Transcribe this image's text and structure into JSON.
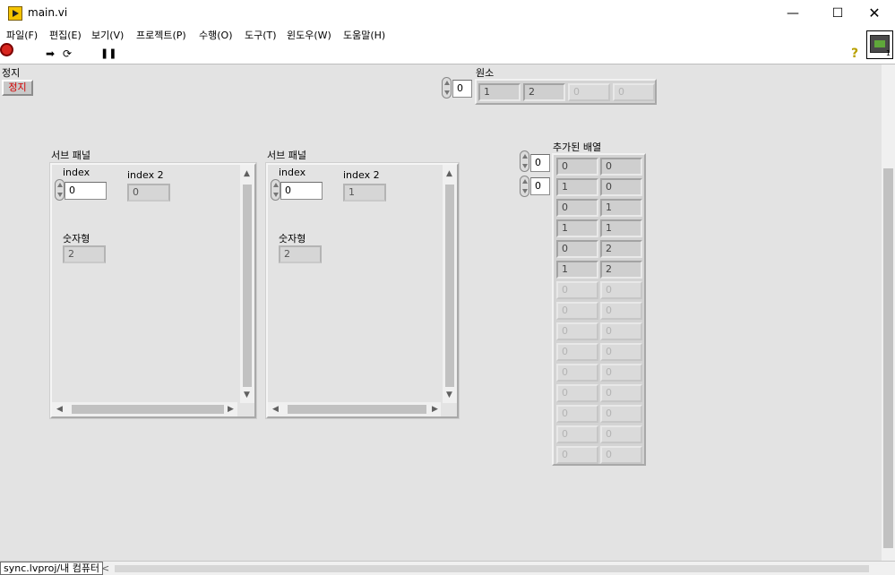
{
  "window": {
    "title": "main.vi",
    "minimize": "—",
    "maximize": "☐",
    "close": "✕"
  },
  "menu": [
    "파일(F)",
    "편집(E)",
    "보기(V)",
    "프로젝트(P)",
    "수행(O)",
    "도구(T)",
    "윈도우(W)",
    "도움말(H)"
  ],
  "toolbar": {
    "run_icon": "run-arrow-icon",
    "run_cont_icon": "run-continuously-icon",
    "abort_icon": "abort-stop-icon",
    "pause_icon": "pause-icon",
    "help": "?",
    "vi_icon_num": "1"
  },
  "stop": {
    "label": "정지",
    "button": "정지"
  },
  "elements": {
    "label": "원소",
    "index": "0",
    "values": [
      "1",
      "2",
      "0",
      "0"
    ],
    "active_count": 2
  },
  "subpanels": [
    {
      "label": "서브 패널",
      "index_label": "index",
      "index_value": "0",
      "index2_label": "index 2",
      "index2_value": "0",
      "num_label": "숫자형",
      "num_value": "2"
    },
    {
      "label": "서브 패널",
      "index_label": "index",
      "index_value": "0",
      "index2_label": "index 2",
      "index2_value": "1",
      "num_label": "숫자형",
      "num_value": "2"
    }
  ],
  "appended": {
    "label": "추가된 배열",
    "row_index": "0",
    "col_index": "0",
    "rows": [
      [
        "0",
        "0"
      ],
      [
        "1",
        "0"
      ],
      [
        "0",
        "1"
      ],
      [
        "1",
        "1"
      ],
      [
        "0",
        "2"
      ],
      [
        "1",
        "2"
      ],
      [
        "0",
        "0"
      ],
      [
        "0",
        "0"
      ],
      [
        "0",
        "0"
      ],
      [
        "0",
        "0"
      ],
      [
        "0",
        "0"
      ],
      [
        "0",
        "0"
      ],
      [
        "0",
        "0"
      ],
      [
        "0",
        "0"
      ],
      [
        "0",
        "0"
      ]
    ],
    "active_rows": 6
  },
  "status": {
    "context": "sync.lvproj/내 컴퓨터",
    "left_arrow": "<"
  }
}
